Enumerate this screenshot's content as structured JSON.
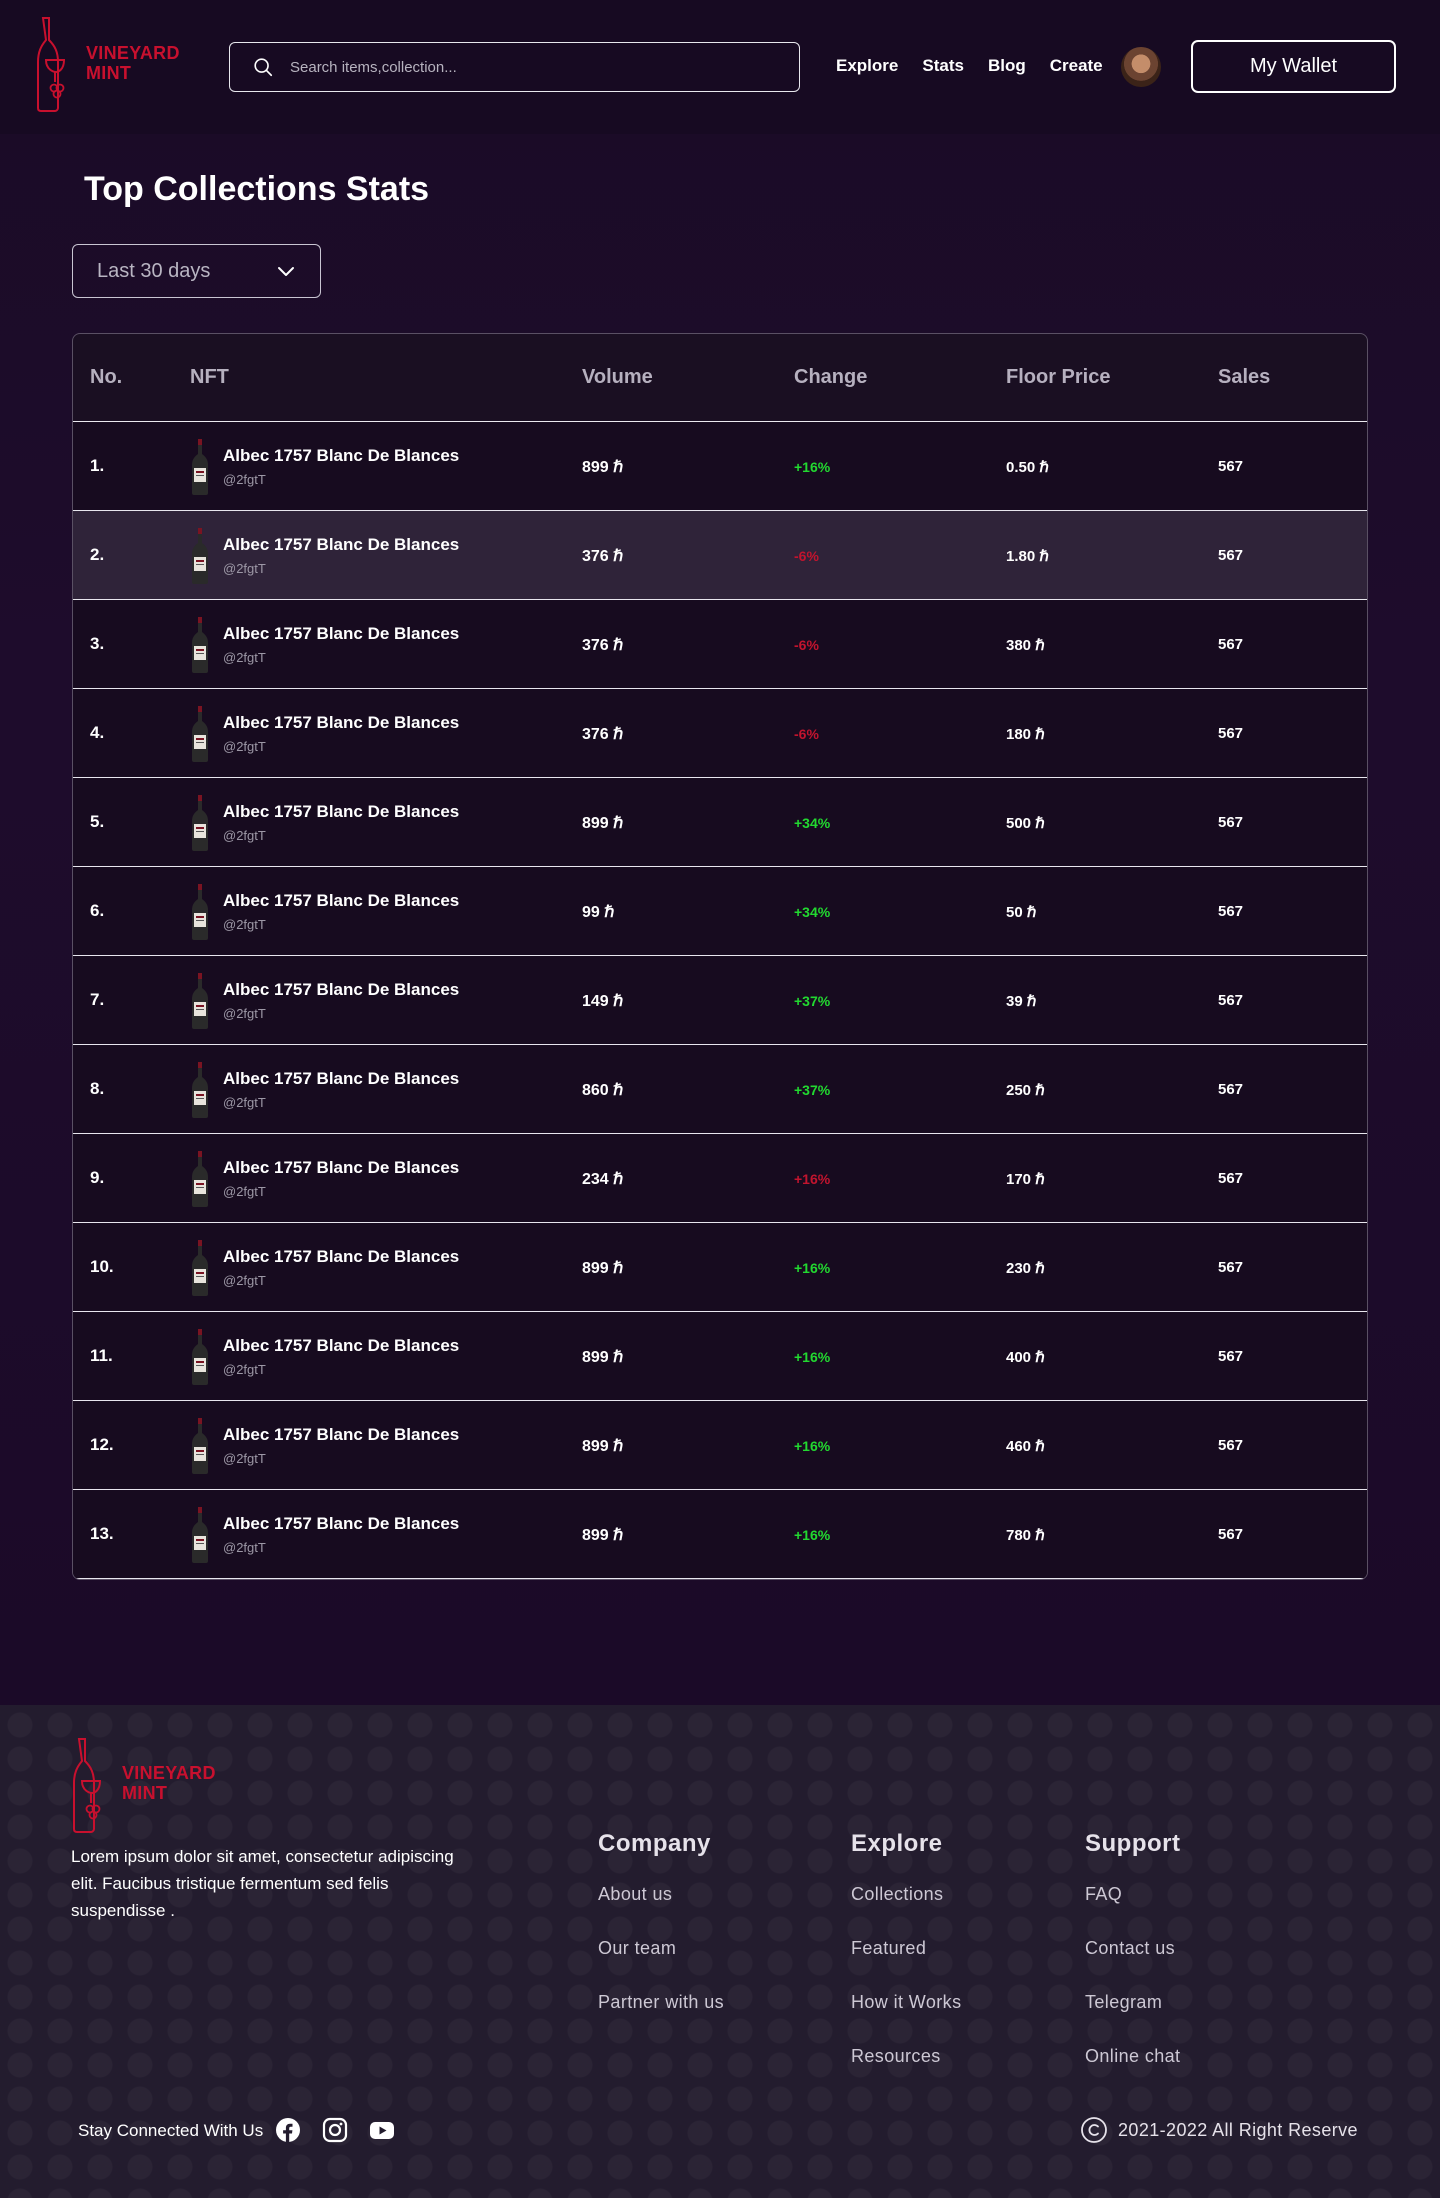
{
  "header": {
    "brand_line1": "VINEYARD",
    "brand_line2": "MINT",
    "search_placeholder": "Search items,collection...",
    "nav": [
      "Explore",
      "Stats",
      "Blog",
      "Create"
    ],
    "wallet_label": "My Wallet"
  },
  "main": {
    "title": "Top Collections Stats",
    "period_selected": "Last 30 days"
  },
  "table": {
    "columns": [
      "No.",
      "NFT",
      "Volume",
      "Change",
      "Floor Price",
      "Sales"
    ],
    "rows": [
      {
        "no": "1.",
        "name": "Albec 1757  Blanc De Blances",
        "handle": "@2fgtT",
        "volume": "899 ℏ",
        "change": "+16%",
        "trend": "up",
        "floor": "0.50 ℏ",
        "sales": "567"
      },
      {
        "no": "2.",
        "name": "Albec 1757  Blanc De Blances",
        "handle": "@2fgtT",
        "volume": "376 ℏ",
        "change": "-6%",
        "trend": "down",
        "floor": "1.80 ℏ",
        "sales": "567"
      },
      {
        "no": "3.",
        "name": "Albec 1757  Blanc De Blances",
        "handle": "@2fgtT",
        "volume": "376 ℏ",
        "change": "-6%",
        "trend": "down",
        "floor": "380 ℏ",
        "sales": "567"
      },
      {
        "no": "4.",
        "name": "Albec 1757  Blanc De Blances",
        "handle": "@2fgtT",
        "volume": "376 ℏ",
        "change": "-6%",
        "trend": "down",
        "floor": "180 ℏ",
        "sales": "567"
      },
      {
        "no": "5.",
        "name": "Albec 1757  Blanc De Blances",
        "handle": "@2fgtT",
        "volume": "899 ℏ",
        "change": "+34%",
        "trend": "up",
        "floor": "500 ℏ",
        "sales": "567"
      },
      {
        "no": "6.",
        "name": "Albec 1757  Blanc De Blances",
        "handle": "@2fgtT",
        "volume": "99 ℏ",
        "change": "+34%",
        "trend": "up",
        "floor": "50 ℏ",
        "sales": "567"
      },
      {
        "no": "7.",
        "name": "Albec 1757  Blanc De Blances",
        "handle": "@2fgtT",
        "volume": "149 ℏ",
        "change": "+37%",
        "trend": "up",
        "floor": "39 ℏ",
        "sales": "567"
      },
      {
        "no": "8.",
        "name": "Albec 1757  Blanc De Blances",
        "handle": "@2fgtT",
        "volume": "860 ℏ",
        "change": "+37%",
        "trend": "up",
        "floor": "250 ℏ",
        "sales": "567"
      },
      {
        "no": "9.",
        "name": "Albec 1757  Blanc De Blances",
        "handle": "@2fgtT",
        "volume": "234 ℏ",
        "change": "+16%",
        "trend": "down",
        "floor": "170 ℏ",
        "sales": "567"
      },
      {
        "no": "10.",
        "name": "Albec 1757  Blanc De Blances",
        "handle": "@2fgtT",
        "volume": "899 ℏ",
        "change": "+16%",
        "trend": "up",
        "floor": "230 ℏ",
        "sales": "567"
      },
      {
        "no": "11.",
        "name": "Albec 1757  Blanc De Blances",
        "handle": "@2fgtT",
        "volume": "899 ℏ",
        "change": "+16%",
        "trend": "up",
        "floor": "400 ℏ",
        "sales": "567"
      },
      {
        "no": "12.",
        "name": "Albec 1757  Blanc De Blances",
        "handle": "@2fgtT",
        "volume": "899 ℏ",
        "change": "+16%",
        "trend": "up",
        "floor": "460 ℏ",
        "sales": "567"
      },
      {
        "no": "13.",
        "name": "Albec 1757  Blanc De Blances",
        "handle": "@2fgtT",
        "volume": "899 ℏ",
        "change": "+16%",
        "trend": "up",
        "floor": "780 ℏ",
        "sales": "567"
      }
    ]
  },
  "footer": {
    "brand_line1": "VINEYARD",
    "brand_line2": "MINT",
    "description": "Lorem ipsum dolor sit amet, consectetur adipiscing elit. Faucibus tristique fermentum sed felis suspendisse .",
    "company": {
      "title": "Company",
      "links": [
        "About us",
        "Our team",
        "Partner with us"
      ]
    },
    "explore": {
      "title": "Explore",
      "links": [
        "Collections",
        "Featured",
        "How it Works",
        "Resources"
      ]
    },
    "support": {
      "title": "Support",
      "links": [
        "FAQ",
        "Contact us",
        "Telegram",
        "Online chat"
      ]
    },
    "stay_connected": "Stay Connected With Us",
    "social_icons": [
      "facebook-icon",
      "instagram-icon",
      "youtube-icon"
    ],
    "copyright": "2021-2022 All Right Reserve"
  },
  "colors": {
    "brand_red": "#c8102e",
    "positive": "#22d930",
    "negative": "#c2142e",
    "background": "#1a0b25"
  }
}
